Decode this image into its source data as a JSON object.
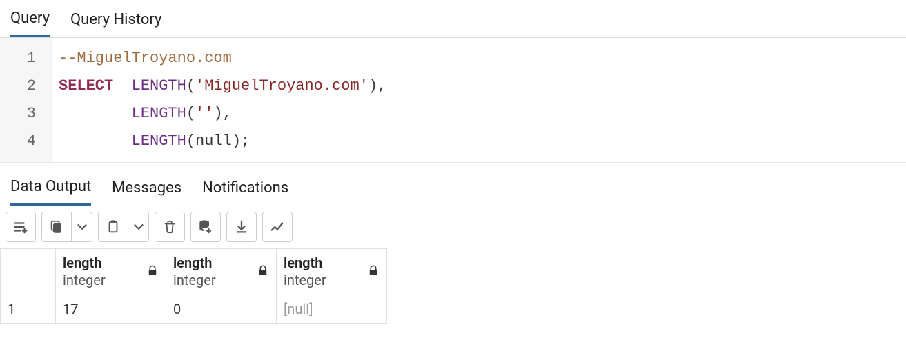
{
  "tabs": {
    "query": "Query",
    "history": "Query History"
  },
  "editor": {
    "lines": [
      "1",
      "2",
      "3",
      "4"
    ],
    "code": {
      "l1_comment": "--MiguelTroyano.com",
      "l2_select": "SELECT",
      "l2_func": "LENGTH",
      "l2_str": "'MiguelTroyano.com'",
      "l2_close": "),",
      "l3_func": "LENGTH",
      "l3_str": "''",
      "l3_close": "),",
      "l4_func": "LENGTH",
      "l4_null": "null",
      "l4_close": ");"
    }
  },
  "lower_tabs": {
    "data": "Data Output",
    "messages": "Messages",
    "notifications": "Notifications"
  },
  "columns": [
    {
      "name": "length",
      "type": "integer"
    },
    {
      "name": "length",
      "type": "integer"
    },
    {
      "name": "length",
      "type": "integer"
    }
  ],
  "rows": [
    {
      "num": "1",
      "cells": [
        "17",
        "0",
        "[null]"
      ],
      "null_flags": [
        false,
        false,
        true
      ]
    }
  ]
}
